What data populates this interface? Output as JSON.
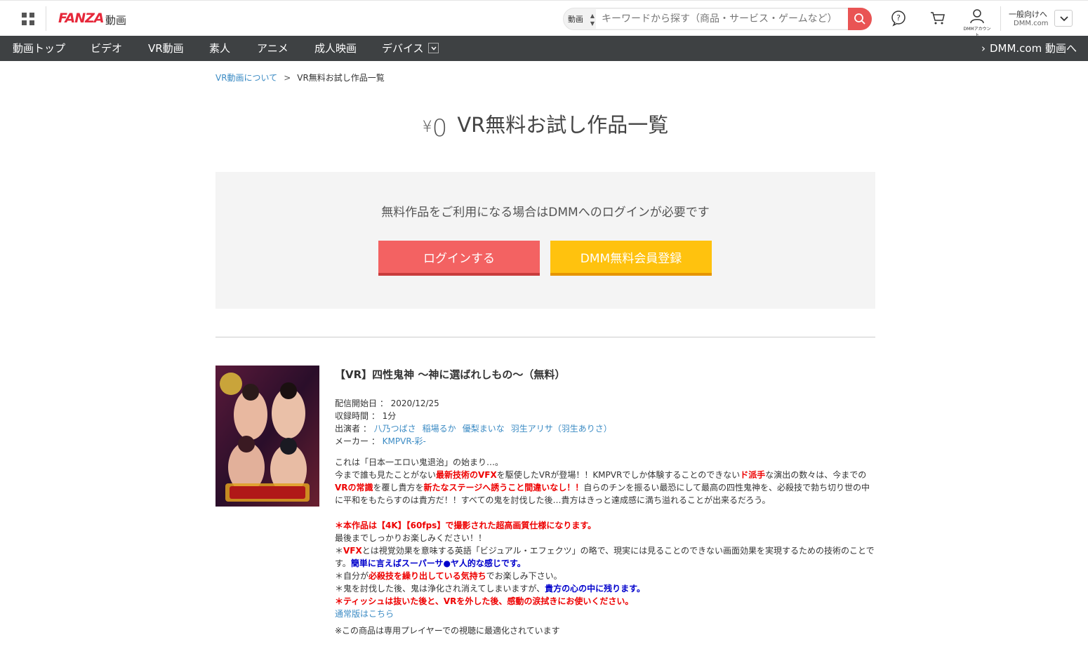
{
  "header": {
    "logo": "FANZA",
    "logo_sub": "動画",
    "search_category": "動画",
    "search_placeholder": "キーワードから探す（商品・サービス・ゲームなど）",
    "account_label": "DMMアカウント",
    "region_label": "一般向けへ",
    "region_site": "DMM.com"
  },
  "nav": {
    "items": [
      "動画トップ",
      "ビデオ",
      "VR動画",
      "素人",
      "アニメ",
      "成人映画",
      "デバイス"
    ],
    "right_link": "DMM.com 動画へ"
  },
  "breadcrumb": {
    "parent": "VR動画について",
    "separator": ">",
    "current": "VR無料お試し作品一覧"
  },
  "title": {
    "yen": "¥",
    "zero": "0",
    "text": "VR無料お試し作品一覧"
  },
  "login": {
    "message": "無料作品をご利用になる場合はDMMへのログインが必要です",
    "login_button": "ログインする",
    "register_button": "DMM無料会員登録"
  },
  "product": {
    "title": "【VR】四性鬼神 ～神に選ばれしもの～（無料）",
    "release_label": "配信開始日 ：",
    "release_date": "2020/12/25",
    "duration_label": "収録時間 ：",
    "duration": "1分",
    "cast_label": "出演者 ：",
    "cast": [
      "八乃つばさ",
      "稲場るか",
      "優梨まいな",
      "羽生アリサ（羽生ありさ）"
    ],
    "maker_label": "メーカー ：",
    "maker": "KMPVR-彩-",
    "desc": {
      "l1": "これは「日本一エロい鬼退治」の始まり…。",
      "l2a": "今まで誰も見たことがない",
      "l2b": "最新技術のVFX",
      "l2c": "を駆使したVRが登場！！KMPVRでしか体験することのできない",
      "l2d": "ド派手",
      "l2e": "な演出の数々は、今までの",
      "l3a": "VRの常識",
      "l3b": "を覆し貴方を",
      "l3c": "新たなステージへ誘うこと間違いなし！！",
      "l3d": "自らのチンを振るい最恐にして最高の四性鬼神を、必殺技で勃ち切り世の中",
      "l4": "に平和をもたらすのは貴方だ！！すべての鬼を討伐した後…貴方はきっと達成感に満ち溢れることが出来るだろう。",
      "l5a": "＊",
      "l5b": "本作品は【4K】【60fps】で撮影された超高画質仕様になります。",
      "l6": "最後までしっかりお楽しみください！！",
      "l7a": "＊",
      "l7b": "VFX",
      "l7c": "とは視覚効果を意味する英語「ビジュアル・エフェクツ」の略で、現実には見ることのできない画面効果を実現するための技術のことで",
      "l8a": "す。",
      "l8b": "簡単に言えばスーパーサ●ヤ人的な感じです。",
      "l9a": "＊自分が",
      "l9b": "必殺技を繰り出している気持ち",
      "l9c": "でお楽しみ下さい。",
      "l10a": "＊鬼を討伐した後、鬼は浄化され消えてしまいますが、",
      "l10b": "貴方の心の中に残ります。",
      "l11a": "＊",
      "l11b": "ティッシュは抜いた後と、VRを外した後、感動の涙拭きにお使いください。",
      "regular_link": "通常版はこちら",
      "note": "※この商品は専用プレイヤーでの視聴に最適化されています"
    }
  }
}
